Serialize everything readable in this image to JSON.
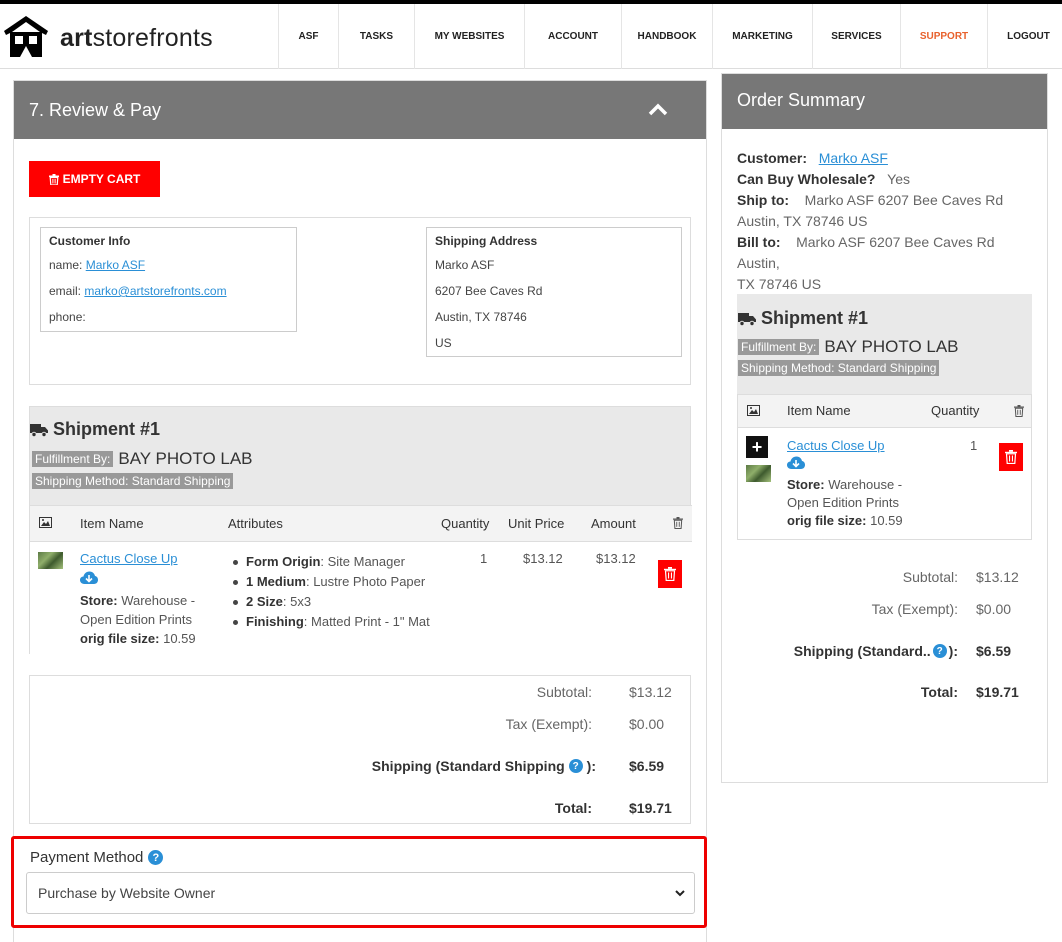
{
  "app": {
    "brand_pre": "art",
    "brand_post": "storefronts"
  },
  "nav": {
    "items": [
      {
        "label": "ASF",
        "width": 60
      },
      {
        "label": "TASKS",
        "width": 76
      },
      {
        "label": "MY WEBSITES",
        "width": 110
      },
      {
        "label": "ACCOUNT",
        "width": 97
      },
      {
        "label": "HANDBOOK",
        "width": 91
      },
      {
        "label": "MARKETING",
        "width": 100
      },
      {
        "label": "SERVICES",
        "width": 88
      },
      {
        "label": "SUPPORT",
        "width": 87
      },
      {
        "label": "LOGOUT",
        "width": 82
      }
    ],
    "active": "SUPPORT"
  },
  "step": {
    "title": "7. Review & Pay"
  },
  "cart": {
    "empty_label": "EMPTY CART"
  },
  "customer_info": {
    "title": "Customer Info",
    "name_label": "name:",
    "name": "Marko ASF",
    "email_label": "email:",
    "email": "marko@artstorefronts.com",
    "phone_label": "phone:"
  },
  "shipping_address": {
    "title": "Shipping Address",
    "lines": [
      "Marko ASF",
      "6207 Bee Caves Rd",
      "Austin, TX 78746",
      "US"
    ]
  },
  "shipment": {
    "title": "Shipment #1",
    "fulfillment_label": "Fulfillment By:",
    "fulfillment_name": "BAY PHOTO LAB",
    "method_label": "Shipping Method: Standard Shipping",
    "columns": {
      "item": "Item Name",
      "attributes": "Attributes",
      "quantity": "Quantity",
      "unit_price": "Unit Price",
      "amount": "Amount"
    },
    "item": {
      "name": "Cactus Close Up",
      "store_label": "Store:",
      "store_line1": "Warehouse -",
      "store_line2": "Open Edition Prints",
      "file_label": "orig file size:",
      "file_size": "10.59",
      "quantity": "1",
      "unit_price": "$13.12",
      "amount": "$13.12",
      "attributes": [
        {
          "key": "Form Origin",
          "sep": ": ",
          "value": "Site Manager"
        },
        {
          "key": "1 Medium",
          "sep": ": ",
          "value": "Lustre Photo Paper"
        },
        {
          "key": "2 Size",
          "sep": ": ",
          "value": "5x3"
        },
        {
          "key": "Finishing",
          "sep": ": ",
          "value": "Matted Print - 1\" Mat"
        }
      ]
    }
  },
  "totals": {
    "subtotal_label": "Subtotal:",
    "subtotal": "$13.12",
    "tax_label": "Tax (Exempt):",
    "tax": "$0.00",
    "shipping_label": "Shipping (Standard Shipping",
    "shipping_suffix": "):",
    "shipping": "$6.59",
    "total_label": "Total:",
    "total": "$19.71"
  },
  "payment": {
    "label": "Payment Method",
    "selected": "Purchase by Website Owner"
  },
  "summary": {
    "title": "Order Summary",
    "customer_label": "Customer:",
    "customer": "Marko ASF",
    "wholesale_label": "Can Buy Wholesale?",
    "wholesale": "Yes",
    "ship_to_label": "Ship to:",
    "ship_to_line1": "Marko ASF 6207 Bee Caves Rd",
    "ship_to_line2": "Austin, TX 78746 US",
    "bill_to_label": "Bill to:",
    "bill_to_line1": "Marko ASF 6207 Bee Caves Rd Austin,",
    "bill_to_line2": "TX 78746 US",
    "shipment_title": "Shipment #1",
    "fulfillment_label": "Fulfillment By:",
    "fulfillment_name": "BAY PHOTO LAB",
    "method_label": "Shipping Method: Standard Shipping",
    "col_item": "Item Name",
    "col_quantity": "Quantity",
    "item_name": "Cactus Close Up",
    "item_qty": "1",
    "store_label": "Store:",
    "store_line1": "Warehouse -",
    "store_line2": "Open Edition Prints",
    "file_label": "orig file size:",
    "file_size": "10.59",
    "subtotal_label": "Subtotal:",
    "subtotal": "$13.12",
    "tax_label": "Tax (Exempt):",
    "tax": "$0.00",
    "shipping_label": "Shipping (Standard..",
    "shipping_suffix": "):",
    "shipping": "$6.59",
    "total_label": "Total:",
    "total": "$19.71"
  },
  "colors": {
    "header_gray": "#777777",
    "danger": "#ff0000",
    "link": "#2a8fd6",
    "active_nav": "#e8612c",
    "highlight": "#e00000"
  }
}
